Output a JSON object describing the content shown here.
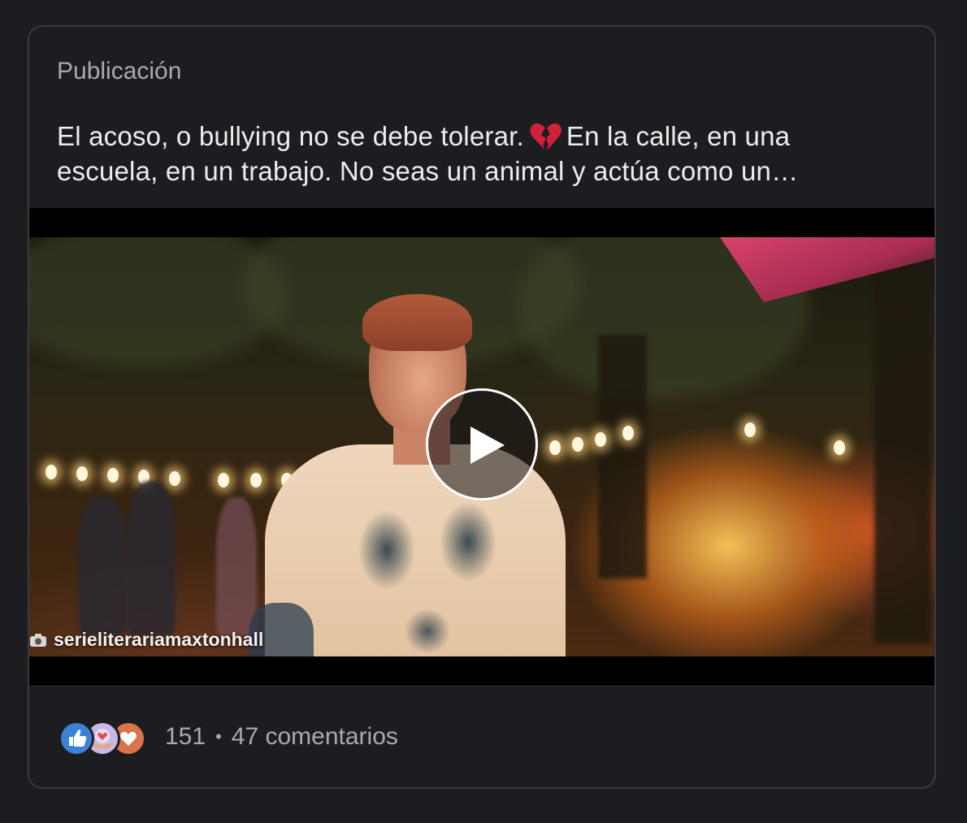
{
  "card": {
    "label": "Publicación"
  },
  "post": {
    "text_line1_before_emoji": "El acoso, o bullying no se debe tolerar.",
    "emoji": "broken-heart-emoji",
    "text_line1_after_emoji": "En la calle, en una",
    "text_line2": "escuela, en un trabajo. No seas un animal y actúa como un…"
  },
  "video": {
    "watermark": "serieliterariamaxtonhall",
    "play_icon": "play-icon"
  },
  "footer": {
    "reactions": [
      "like-icon",
      "care-icon",
      "love-icon"
    ],
    "reaction_count": "151",
    "separator": "•",
    "comments": "47 comentarios"
  },
  "colors": {
    "background": "#1c1d21",
    "text": "#ecedef",
    "muted": "#a9aaae",
    "like": "#3b82d6",
    "care": "#c9b8e6",
    "love": "#d9744a"
  }
}
